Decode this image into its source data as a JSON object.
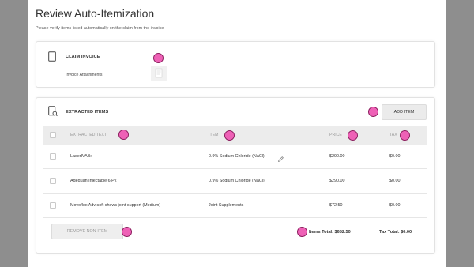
{
  "page": {
    "title": "Review Auto-Itemization",
    "subtitle": "Please verify items listed automatically on the claim from the invoice"
  },
  "claim_invoice": {
    "title": "CLAIM INVOICE",
    "attachments_label": "Invoice Attachments"
  },
  "extracted_items": {
    "title": "EXTRACTED ITEMS",
    "add_button": "ADD ITEM",
    "columns": [
      "EXTRACTED TEXT",
      "ITEM",
      "PRICE",
      "TAX"
    ],
    "rows": [
      {
        "text": "LaserIVABx",
        "item": "0.9% Sodium Chloride (NaCl)",
        "price": "$290.00",
        "tax": "$0.00"
      },
      {
        "text": "Adequan Injectable 6 Pk",
        "item": "0.9% Sodium Chloride (NaCl)",
        "price": "$290.00",
        "tax": "$0.00"
      },
      {
        "text": "Movoflex Adv soft chews joint support (Medium)",
        "item": "Joint Supplements",
        "price": "$72.50",
        "tax": "$0.00"
      }
    ],
    "remove_button": "REMOVE NON-ITEM",
    "items_total": "Items Total: $652.50",
    "tax_total": "Tax Total: $0.00"
  },
  "colors": {
    "highlight": "#ee61b6",
    "background": "#8e8e8e",
    "panel": "#ffffff"
  }
}
